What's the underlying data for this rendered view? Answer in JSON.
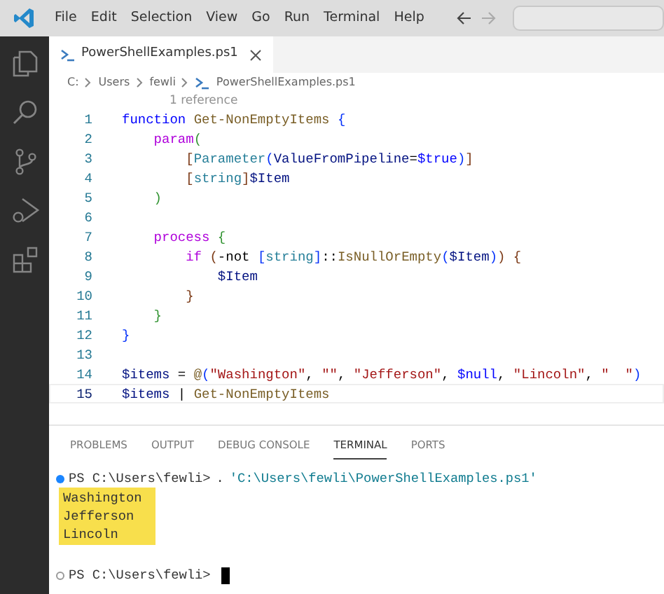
{
  "menu": [
    "File",
    "Edit",
    "Selection",
    "View",
    "Go",
    "Run",
    "Terminal",
    "Help"
  ],
  "activity_bar": [
    {
      "kind": "files",
      "selected": false
    },
    {
      "kind": "search",
      "selected": false
    },
    {
      "kind": "source-control",
      "selected": false
    },
    {
      "kind": "run-debug",
      "selected": false
    },
    {
      "kind": "extensions",
      "selected": false
    }
  ],
  "tabs": [
    {
      "label": "PowerShellExamples.ps1",
      "selected": true
    }
  ],
  "breadcrumb": [
    {
      "label": "C:",
      "file": false
    },
    {
      "label": "Users",
      "file": false
    },
    {
      "label": "fewli",
      "file": false
    },
    {
      "label": "PowerShellExamples.ps1",
      "file": true
    }
  ],
  "codelens": "1 reference",
  "code": [
    {
      "number": "1",
      "current": false,
      "tokens": [
        {
          "kind": "keyword",
          "text": "function "
        },
        {
          "kind": "function",
          "text": "Get-NonEmptyItems "
        },
        {
          "kind": "brace1",
          "text": "{"
        }
      ]
    },
    {
      "number": "2",
      "current": false,
      "tokens": [
        {
          "kind": "control",
          "text": "    param"
        },
        {
          "kind": "brace2",
          "text": "("
        }
      ]
    },
    {
      "number": "3",
      "current": false,
      "tokens": [
        {
          "kind": "brace3",
          "text": "        ["
        },
        {
          "kind": "type",
          "text": "Parameter"
        },
        {
          "kind": "brace1",
          "text": "("
        },
        {
          "kind": "variable",
          "text": "ValueFromPipeline"
        },
        {
          "kind": "plain",
          "text": "="
        },
        {
          "kind": "constant",
          "text": "$true"
        },
        {
          "kind": "brace1",
          "text": ")"
        },
        {
          "kind": "brace3",
          "text": "]"
        }
      ]
    },
    {
      "number": "4",
      "current": false,
      "tokens": [
        {
          "kind": "brace3",
          "text": "        ["
        },
        {
          "kind": "type",
          "text": "string"
        },
        {
          "kind": "brace3",
          "text": "]"
        },
        {
          "kind": "variable",
          "text": "$Item"
        }
      ]
    },
    {
      "number": "5",
      "current": false,
      "tokens": [
        {
          "kind": "brace2",
          "text": "    )"
        }
      ]
    },
    {
      "number": "6",
      "current": false
    },
    {
      "number": "7",
      "current": false,
      "tokens": [
        {
          "kind": "control",
          "text": "    process "
        },
        {
          "kind": "brace2",
          "text": "{"
        }
      ]
    },
    {
      "number": "8",
      "current": false,
      "tokens": [
        {
          "kind": "control",
          "text": "        if "
        },
        {
          "kind": "brace3",
          "text": "("
        },
        {
          "kind": "operator",
          "text": "-not "
        },
        {
          "kind": "brace1",
          "text": "["
        },
        {
          "kind": "type",
          "text": "string"
        },
        {
          "kind": "brace1",
          "text": "]"
        },
        {
          "kind": "plain",
          "text": "::"
        },
        {
          "kind": "function",
          "text": "IsNullOrEmpty"
        },
        {
          "kind": "brace1",
          "text": "("
        },
        {
          "kind": "variable",
          "text": "$Item"
        },
        {
          "kind": "brace1",
          "text": ")"
        },
        {
          "kind": "brace3",
          "text": ") {"
        }
      ]
    },
    {
      "number": "9",
      "current": false,
      "tokens": [
        {
          "kind": "variable",
          "text": "            $Item"
        }
      ]
    },
    {
      "number": "10",
      "current": false,
      "tokens": [
        {
          "kind": "brace3",
          "text": "        }"
        }
      ]
    },
    {
      "number": "11",
      "current": false,
      "tokens": [
        {
          "kind": "brace2",
          "text": "    }"
        }
      ]
    },
    {
      "number": "12",
      "current": false,
      "tokens": [
        {
          "kind": "brace1",
          "text": "}"
        }
      ]
    },
    {
      "number": "13",
      "current": false
    },
    {
      "number": "14",
      "current": false,
      "tokens": [
        {
          "kind": "variable",
          "text": "$items"
        },
        {
          "kind": "plain",
          "text": " = "
        },
        {
          "kind": "function",
          "text": "@"
        },
        {
          "kind": "brace1",
          "text": "("
        },
        {
          "kind": "string",
          "text": "\"Washington\""
        },
        {
          "kind": "plain",
          "text": ", "
        },
        {
          "kind": "string",
          "text": "\"\""
        },
        {
          "kind": "plain",
          "text": ", "
        },
        {
          "kind": "string",
          "text": "\"Jefferson\""
        },
        {
          "kind": "plain",
          "text": ", "
        },
        {
          "kind": "constant",
          "text": "$null"
        },
        {
          "kind": "plain",
          "text": ", "
        },
        {
          "kind": "string",
          "text": "\"Lincoln\""
        },
        {
          "kind": "plain",
          "text": ", "
        },
        {
          "kind": "string",
          "text": "\"  \""
        },
        {
          "kind": "brace1",
          "text": ")"
        }
      ]
    },
    {
      "number": "15",
      "current": true,
      "tokens": [
        {
          "kind": "variable",
          "text": "$items"
        },
        {
          "kind": "plain",
          "text": " | "
        },
        {
          "kind": "function",
          "text": "Get-NonEmptyItems"
        }
      ]
    }
  ],
  "panel_tabs": [
    {
      "label": "PROBLEMS",
      "selected": false
    },
    {
      "label": "OUTPUT",
      "selected": false
    },
    {
      "label": "DEBUG CONSOLE",
      "selected": false
    },
    {
      "label": "TERMINAL",
      "selected": true
    },
    {
      "label": "PORTS",
      "selected": false
    }
  ],
  "terminal": [
    {
      "kind": "command",
      "succeeded": true,
      "prompt": "PS C:\\Users\\fewli>",
      "operator": ".",
      "argument": "'C:\\Users\\fewli\\PowerShellExamples.ps1'"
    },
    {
      "kind": "output",
      "highlighted": true,
      "lines": [
        "Washington",
        "Jefferson",
        "Lincoln"
      ]
    },
    {
      "kind": "command",
      "succeeded": false,
      "prompt": "PS C:\\Users\\fewli>",
      "cursor": true
    }
  ]
}
